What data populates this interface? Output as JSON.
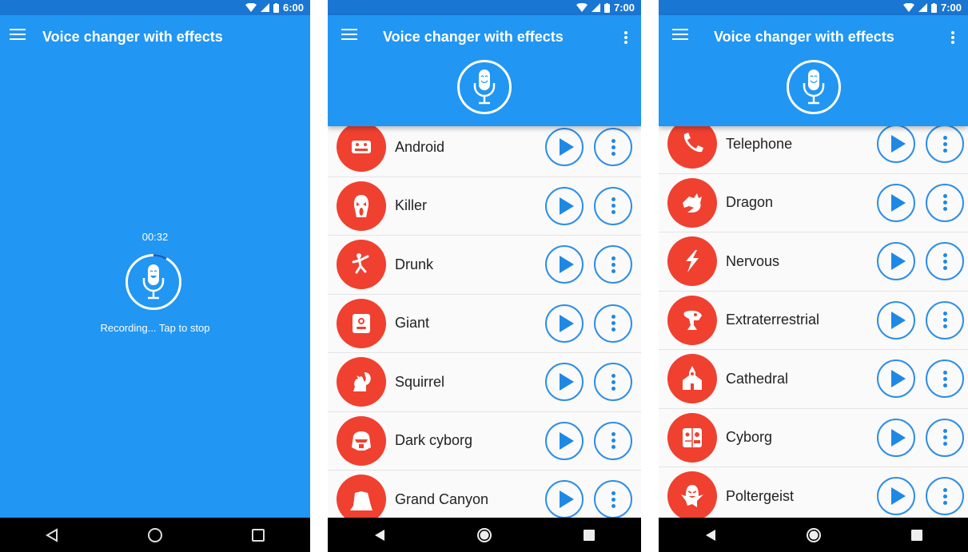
{
  "app_title": "Voice changer with effects",
  "colors": {
    "primary": "#2196f3",
    "status_bar": "#1976d2",
    "effect_icon_bg": "#f04030",
    "accent_outline": "#2e8ee6"
  },
  "phones": [
    {
      "status": {
        "time": "6:00",
        "icons": [
          "wifi-icon",
          "signal-icon",
          "battery-icon"
        ]
      },
      "recording": {
        "elapsed": "00:32",
        "hint": "Recording... Tap to stop",
        "progress_fraction": 0.08
      },
      "nav": [
        "back-icon",
        "home-icon",
        "recents-icon"
      ]
    },
    {
      "status": {
        "time": "7:00",
        "icons": [
          "wifi-icon",
          "signal-icon",
          "battery-icon"
        ]
      },
      "effects": [
        {
          "label": "Android",
          "icon": "robot-icon"
        },
        {
          "label": "Killer",
          "icon": "ghost-mask-icon"
        },
        {
          "label": "Drunk",
          "icon": "drunk-person-icon"
        },
        {
          "label": "Giant",
          "icon": "giant-icon"
        },
        {
          "label": "Squirrel",
          "icon": "squirrel-icon"
        },
        {
          "label": "Dark cyborg",
          "icon": "dark-helmet-icon"
        },
        {
          "label": "Grand Canyon",
          "icon": "canyon-icon"
        }
      ],
      "nav": [
        "back-icon",
        "home-icon",
        "recents-icon"
      ]
    },
    {
      "status": {
        "time": "7:00",
        "icons": [
          "wifi-icon",
          "signal-icon",
          "battery-icon"
        ]
      },
      "effects": [
        {
          "label": "Telephone",
          "icon": "telephone-icon"
        },
        {
          "label": "Dragon",
          "icon": "dragon-icon"
        },
        {
          "label": "Nervous",
          "icon": "lightning-icon"
        },
        {
          "label": "Extraterrestrial",
          "icon": "alien-icon"
        },
        {
          "label": "Cathedral",
          "icon": "cathedral-icon"
        },
        {
          "label": "Cyborg",
          "icon": "cyborg-icon"
        },
        {
          "label": "Poltergeist",
          "icon": "poltergeist-icon"
        }
      ],
      "nav": [
        "back-icon",
        "home-icon",
        "recents-icon"
      ]
    }
  ]
}
